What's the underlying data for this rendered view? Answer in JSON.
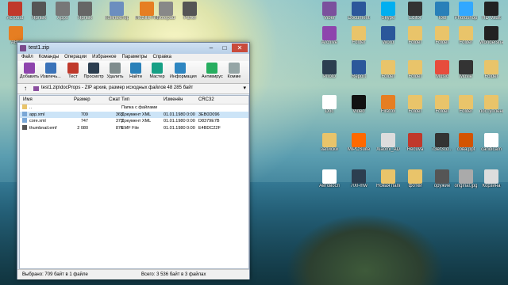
{
  "desktop": {
    "icons": [
      {
        "label": "Acrobat",
        "color": "#c0392b"
      },
      {
        "label": "Ярлык",
        "color": "#555"
      },
      {
        "label": "Apps",
        "color": "#777"
      },
      {
        "label": "Ярлык",
        "color": "#666"
      },
      {
        "label": "Компьютер",
        "color": "#6c8ebf"
      },
      {
        "label": "Mozilla Firefox",
        "color": "#e67e22"
      },
      {
        "label": "Notepad",
        "color": "#888"
      },
      {
        "label": "Panel",
        "color": "#555"
      },
      {
        "label": "Viber",
        "color": "#7b519d"
      },
      {
        "label": "Document",
        "color": "#2b579a"
      },
      {
        "label": "Skype",
        "color": "#00aff0"
      },
      {
        "label": "Editor",
        "color": "#333"
      },
      {
        "label": "Tool",
        "color": "#2980b9"
      },
      {
        "label": "Photoshop",
        "color": "#31a8ff"
      },
      {
        "label": "HD Vault",
        "color": "#222"
      },
      {
        "label": "ABC",
        "color": "#e67e22"
      },
      {
        "label": "Archive",
        "color": "#8e44ad"
      },
      {
        "label": "Folder",
        "color": "#e9c46a"
      },
      {
        "label": "Word",
        "color": "#2b579a"
      },
      {
        "label": "Folder",
        "color": "#e9c46a"
      },
      {
        "label": "Folder",
        "color": "#e9c46a"
      },
      {
        "label": "Folder",
        "color": "#e9c46a"
      },
      {
        "label": "Wondershare",
        "color": "#222"
      },
      {
        "label": "Photo",
        "color": "#2c3e50"
      },
      {
        "label": "Report",
        "color": "#2b579a"
      },
      {
        "label": "Folder",
        "color": "#e9c46a"
      },
      {
        "label": "Folder",
        "color": "#e9c46a"
      },
      {
        "label": "Music",
        "color": "#e74c3c"
      },
      {
        "label": "Movie",
        "color": "#333"
      },
      {
        "label": "Folder",
        "color": "#e9c46a"
      },
      {
        "label": "Doc",
        "color": "#fff"
      },
      {
        "label": "Video",
        "color": "#111"
      },
      {
        "label": "Firefox",
        "color": "#e67e22"
      },
      {
        "label": "Folder",
        "color": "#e9c46a"
      },
      {
        "label": "Folder",
        "color": "#e9c46a"
      },
      {
        "label": "Folder",
        "color": "#e9c46a"
      },
      {
        "label": "поступление",
        "color": "#e9c46a"
      },
      {
        "label": "записки",
        "color": "#e9c46a"
      },
      {
        "label": "MiPCSuite",
        "color": "#ff6900"
      },
      {
        "label": "Xiaomi_AD",
        "color": "#ddd"
      },
      {
        "label": "Recuva",
        "color": "#c0392b"
      },
      {
        "label": "73ef3cd...",
        "color": "#333"
      },
      {
        "label": "сова.ppt",
        "color": "#d35400"
      },
      {
        "label": "candicam",
        "color": "#fff"
      },
      {
        "label": "Автовосп",
        "color": "#fff"
      },
      {
        "label": "700-mw",
        "color": "#2c3e50"
      },
      {
        "label": "Новая папка",
        "color": "#e9c46a"
      },
      {
        "label": "фотки",
        "color": "#e9c46a"
      },
      {
        "label": "оружие",
        "color": "#555"
      },
      {
        "label": "original.jpg",
        "color": "#aaa"
      },
      {
        "label": "Корзина",
        "color": "#ddd"
      }
    ]
  },
  "window": {
    "title": "test1.zip",
    "menu": [
      "Файл",
      "Команды",
      "Операции",
      "Избранное",
      "Параметры",
      "Справка"
    ],
    "toolbar": [
      {
        "label": "Добавить",
        "color": "#8e44ad"
      },
      {
        "label": "Извлечь...",
        "color": "#3b73b9"
      },
      {
        "label": "Тест",
        "color": "#c0392b"
      },
      {
        "label": "Просмотр",
        "color": "#2c3e50"
      },
      {
        "label": "Удалить",
        "color": "#7f8c8d"
      },
      {
        "label": "Найти",
        "color": "#2980b9"
      },
      {
        "label": "Мастер",
        "color": "#16a085"
      },
      {
        "label": "Информация",
        "color": "#2e86c1"
      },
      {
        "label": "Антивирус",
        "color": "#27ae60"
      },
      {
        "label": "Комме",
        "color": "#95a5a6"
      }
    ],
    "path": "test1.zip\\docProps - ZIP архив, размер исходных файлов 48 285 байт",
    "columns": [
      "Имя",
      "Размер",
      "Сжат",
      "Тип",
      "Изменён",
      "CRC32"
    ],
    "rows": [
      {
        "name": "..",
        "size": "",
        "packed": "",
        "type": "Папка с файлами",
        "modified": "",
        "crc": "",
        "selected": false,
        "icon": "folder"
      },
      {
        "name": "app.xml",
        "size": "709",
        "packed": "365",
        "type": "Документ XML",
        "modified": "01.01.1980 0:00",
        "crc": "3EB0D096",
        "selected": true,
        "icon": "xml"
      },
      {
        "name": "core.xml",
        "size": "747",
        "packed": "375",
        "type": "Документ XML",
        "modified": "01.01.1980 0:00",
        "crc": "D8379E7B",
        "selected": false,
        "icon": "xml"
      },
      {
        "name": "thumbnail.emf",
        "size": "2 080",
        "packed": "876",
        "type": "EMF File",
        "modified": "01.01.1980 0:00",
        "crc": "E4BDC22F",
        "selected": false,
        "icon": "emf"
      }
    ],
    "status_left": "Выбрано: 709 байт в 1 файле",
    "status_right": "Всего: 3 536 байт в 3 файлах"
  }
}
